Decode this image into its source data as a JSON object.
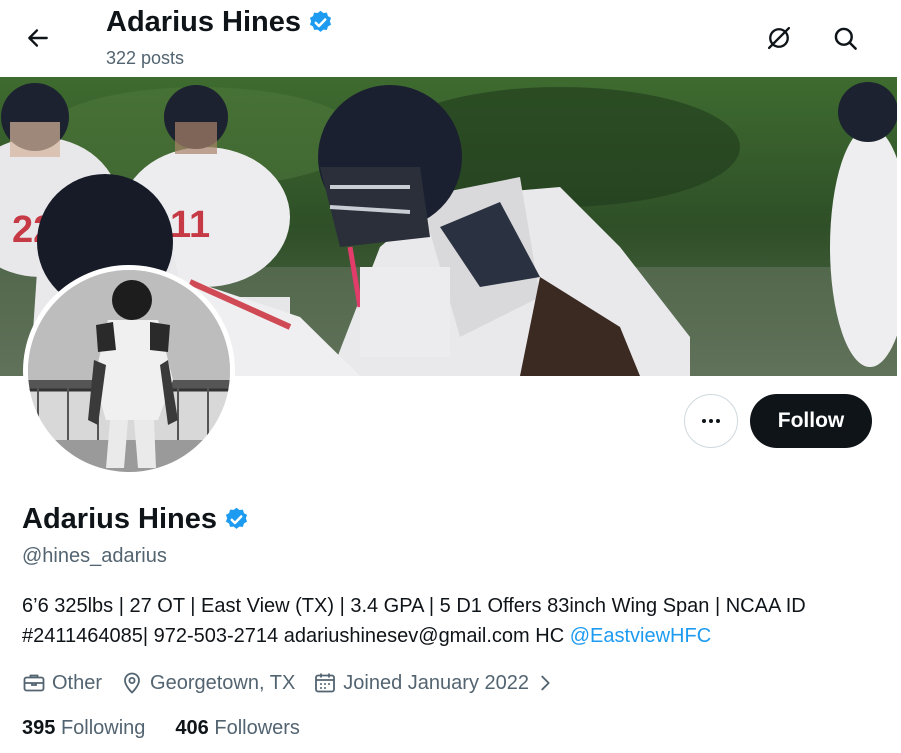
{
  "header": {
    "name": "Adarius Hines",
    "posts_count": "322 posts"
  },
  "profile": {
    "display_name": "Adarius Hines",
    "handle": "@hines_adarius",
    "bio_text": "6’6 325lbs | 27 OT | East View (TX) | 3.4 GPA | 5 D1 Offers 83inch Wing Span | NCAA ID #2411464085| 972-503-2714 adariushinesev@gmail.com HC ",
    "bio_mention": "@EastviewHFC",
    "category": "Other",
    "location": "Georgetown, TX",
    "joined": "Joined January 2022",
    "following_count": "395",
    "following_label": "Following",
    "followers_count": "406",
    "followers_label": "Followers"
  },
  "actions": {
    "follow_label": "Follow"
  },
  "icons": {
    "back": "arrow-left-icon",
    "grok": "grok-icon",
    "search": "search-icon",
    "verified": "verified-badge-icon",
    "more": "more-dots-icon",
    "category": "briefcase-icon",
    "location": "location-pin-icon",
    "calendar": "calendar-icon",
    "chevron": "chevron-right-icon"
  },
  "colors": {
    "accent": "#1d9bf0",
    "text": "#0f1419",
    "secondary": "#536471",
    "follow_button_bg": "#0f1419"
  }
}
